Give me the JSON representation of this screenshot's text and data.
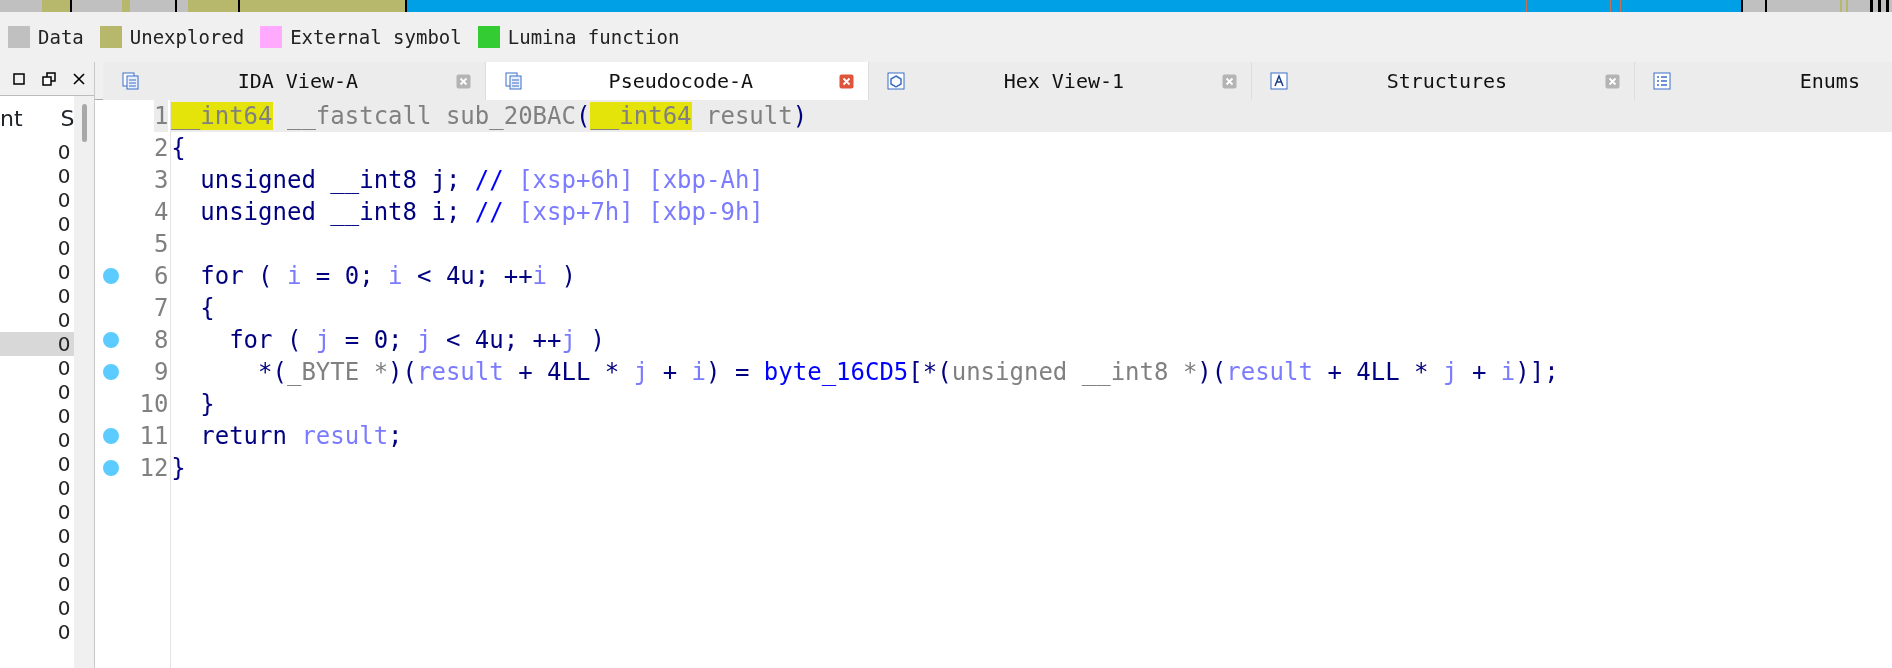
{
  "legend": [
    {
      "label": "Data",
      "color": "#c0c0c0"
    },
    {
      "label": "Unexplored",
      "color": "#b8b86c"
    },
    {
      "label": "External symbol",
      "color": "#ffaaff"
    },
    {
      "label": "Lumina function",
      "color": "#33cc33"
    }
  ],
  "left_panel": {
    "column_1": "nt",
    "column_2": "S",
    "rows": [
      {
        "text": "0",
        "selected": false
      },
      {
        "text": "0",
        "selected": false
      },
      {
        "text": "0",
        "selected": false
      },
      {
        "text": "0",
        "selected": false
      },
      {
        "text": "0",
        "selected": false
      },
      {
        "text": "0",
        "selected": false
      },
      {
        "text": "0",
        "selected": false
      },
      {
        "text": "0",
        "selected": false
      },
      {
        "text": "0",
        "selected": true
      },
      {
        "text": "0",
        "selected": false
      },
      {
        "text": "0",
        "selected": false
      },
      {
        "text": "0",
        "selected": false
      },
      {
        "text": "0",
        "selected": false
      },
      {
        "text": "0",
        "selected": false
      },
      {
        "text": "0",
        "selected": false
      },
      {
        "text": "0",
        "selected": false
      },
      {
        "text": "0",
        "selected": false
      },
      {
        "text": "0",
        "selected": false
      },
      {
        "text": "0",
        "selected": false
      },
      {
        "text": "0",
        "selected": false
      },
      {
        "text": "0",
        "selected": false
      }
    ]
  },
  "tabs": [
    {
      "label": "IDA View-A",
      "kind": "disasm",
      "selected": false
    },
    {
      "label": "Pseudocode-A",
      "kind": "pseudo",
      "selected": true
    },
    {
      "label": "Hex View-1",
      "kind": "hex",
      "selected": false
    },
    {
      "label": "Structures",
      "kind": "struct",
      "selected": false
    },
    {
      "label": "Enums",
      "kind": "enum",
      "selected": false
    }
  ],
  "code": [
    {
      "number": "1",
      "breakpoint": false,
      "current": true,
      "tokens": [
        {
          "text": "__int64",
          "kind": "highlight"
        },
        {
          "text": " __fastcall sub_20BAC",
          "kind": "muted"
        },
        {
          "text": "(",
          "kind": "plain"
        },
        {
          "text": "__int64",
          "kind": "highlight"
        },
        {
          "text": " result",
          "kind": "muted"
        },
        {
          "text": ")",
          "kind": "plain"
        }
      ]
    },
    {
      "number": "2",
      "breakpoint": false,
      "current": false,
      "tokens": [
        {
          "text": "{",
          "kind": "plain"
        }
      ]
    },
    {
      "number": "3",
      "breakpoint": false,
      "current": false,
      "tokens": [
        {
          "text": "  unsigned __int8 j; ",
          "kind": "plain"
        },
        {
          "text": "//",
          "kind": "comment"
        },
        {
          "text": " [xsp+6h] [xbp-Ah]",
          "kind": "variable"
        }
      ]
    },
    {
      "number": "4",
      "breakpoint": false,
      "current": false,
      "tokens": [
        {
          "text": "  unsigned __int8 i; ",
          "kind": "plain"
        },
        {
          "text": "//",
          "kind": "comment"
        },
        {
          "text": " [xsp+7h] [xbp-9h]",
          "kind": "variable"
        }
      ]
    },
    {
      "number": "5",
      "breakpoint": false,
      "current": false
    },
    {
      "number": "6",
      "breakpoint": true,
      "current": false,
      "tokens": [
        {
          "text": "  for ( ",
          "kind": "plain"
        },
        {
          "text": "i",
          "kind": "variable"
        },
        {
          "text": " = 0; ",
          "kind": "plain"
        },
        {
          "text": "i",
          "kind": "variable"
        },
        {
          "text": " < 4u; ++",
          "kind": "plain"
        },
        {
          "text": "i",
          "kind": "variable"
        },
        {
          "text": " )",
          "kind": "plain"
        }
      ]
    },
    {
      "number": "7",
      "breakpoint": false,
      "current": false,
      "tokens": [
        {
          "text": "  {",
          "kind": "plain"
        }
      ]
    },
    {
      "number": "8",
      "breakpoint": true,
      "current": false,
      "tokens": [
        {
          "text": "    for ( ",
          "kind": "plain"
        },
        {
          "text": "j",
          "kind": "variable"
        },
        {
          "text": " = 0; ",
          "kind": "plain"
        },
        {
          "text": "j",
          "kind": "variable"
        },
        {
          "text": " < 4u; ++",
          "kind": "plain"
        },
        {
          "text": "j",
          "kind": "variable"
        },
        {
          "text": " )",
          "kind": "plain"
        }
      ]
    },
    {
      "number": "9",
      "breakpoint": true,
      "current": false,
      "tokens": [
        {
          "text": "      *(",
          "kind": "plain"
        },
        {
          "text": "_BYTE *",
          "kind": "muted"
        },
        {
          "text": ")(",
          "kind": "plain"
        },
        {
          "text": "result",
          "kind": "variable"
        },
        {
          "text": " + 4LL * ",
          "kind": "plain"
        },
        {
          "text": "j",
          "kind": "variable"
        },
        {
          "text": " + ",
          "kind": "plain"
        },
        {
          "text": "i",
          "kind": "variable"
        },
        {
          "text": ") = ",
          "kind": "plain"
        },
        {
          "text": "byte_16CD5",
          "kind": "name"
        },
        {
          "text": "[*(",
          "kind": "plain"
        },
        {
          "text": "unsigned __int8 *",
          "kind": "muted"
        },
        {
          "text": ")(",
          "kind": "plain"
        },
        {
          "text": "result",
          "kind": "variable"
        },
        {
          "text": " + 4LL * ",
          "kind": "plain"
        },
        {
          "text": "j",
          "kind": "variable"
        },
        {
          "text": " + ",
          "kind": "plain"
        },
        {
          "text": "i",
          "kind": "variable"
        },
        {
          "text": ")];",
          "kind": "plain"
        }
      ]
    },
    {
      "number": "10",
      "breakpoint": false,
      "current": false,
      "tokens": [
        {
          "text": "  }",
          "kind": "plain"
        }
      ]
    },
    {
      "number": "11",
      "breakpoint": true,
      "current": false,
      "tokens": [
        {
          "text": "  return ",
          "kind": "plain"
        },
        {
          "text": "result",
          "kind": "variable"
        },
        {
          "text": ";",
          "kind": "plain"
        }
      ]
    },
    {
      "number": "12",
      "breakpoint": true,
      "current": false,
      "tokens": [
        {
          "text": "}",
          "kind": "plain"
        }
      ]
    }
  ]
}
